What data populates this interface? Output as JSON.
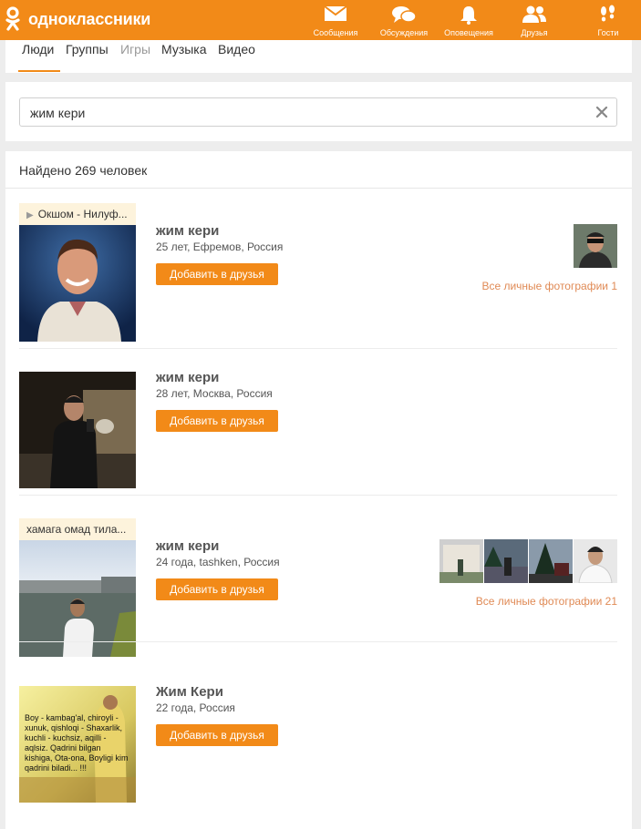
{
  "header": {
    "logo_text": "одноклассники",
    "nav": [
      {
        "label": "Сообщения",
        "icon": "envelope-icon"
      },
      {
        "label": "Обсуждения",
        "icon": "chat-bubbles-icon"
      },
      {
        "label": "Оповещения",
        "icon": "bell-icon"
      },
      {
        "label": "Друзья",
        "icon": "friends-icon"
      },
      {
        "label": "Гости",
        "icon": "footprints-icon"
      }
    ]
  },
  "tabs": [
    {
      "label": "Люди",
      "active": true
    },
    {
      "label": "Группы",
      "active": false
    },
    {
      "label": "Игры",
      "active": false
    },
    {
      "label": "Музыка",
      "active": false
    },
    {
      "label": "Видео",
      "active": false
    }
  ],
  "search": {
    "value": "жим кери",
    "clear_icon": "close-icon"
  },
  "results": {
    "found_text": "Найдено 269 человек",
    "add_button_label": "Добавить в друзья",
    "people": [
      {
        "status": "Окшом - Нилуф...",
        "status_icon": "play-icon",
        "name": "жим кери",
        "details": "25 лет, Ефремов, Россия",
        "photos_link": "Все личные фотографии 1",
        "thumb_count": 1
      },
      {
        "name": "жим кери",
        "details": "28 лет, Москва, Россия",
        "thumb_count": 0
      },
      {
        "status": "хамага омад тила...",
        "name": "жим кери",
        "details": "24 года, tashken, Россия",
        "photos_link": "Все личные фотографии 21",
        "thumb_count": 4
      },
      {
        "photo_caption": "Boy - kambag'al, chiroyli - xunuk, qishloqi - Shaxarlik, kuchli - kuchsiz, aqilli - aqlsiz. Qadrini bilgan kishiga, Ota-ona, Boyligi kim qadrini biladi... !!!",
        "name": "Жим Кери",
        "details": "22 года, Россия",
        "thumb_count": 0
      }
    ]
  },
  "colors": {
    "accent": "#f28a18",
    "link": "#e08a55",
    "status_bg": "#fdf3dc"
  }
}
